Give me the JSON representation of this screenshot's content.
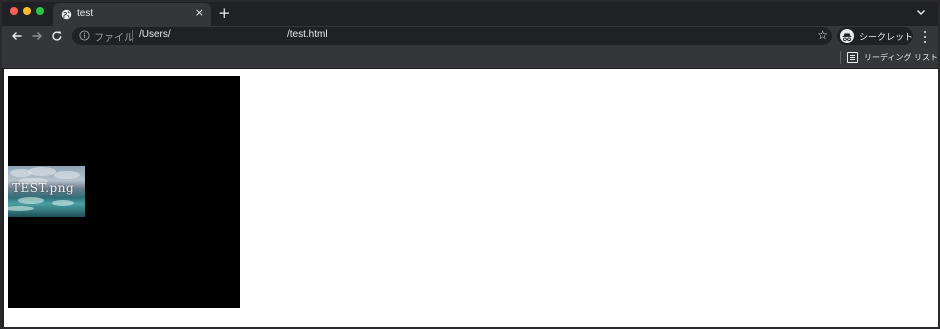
{
  "window": {
    "controls": [
      "close",
      "minimize",
      "maximize"
    ]
  },
  "tab": {
    "title": "test",
    "icon": "globe-icon",
    "close_glyph": "×"
  },
  "new_tab_glyph": "+",
  "toolbar": {
    "back_icon": "arrow-left-icon",
    "forward_icon": "arrow-right-icon",
    "reload_icon": "reload-icon",
    "address": {
      "scheme_label": "ファイル",
      "url_part1": "/Users/",
      "url_part2": "/test.html",
      "bookmark_icon": "star-icon",
      "star_glyph": "☆"
    },
    "incognito_label": "シークレット",
    "menu_icon": "more-vert-icon"
  },
  "bookmarks_bar": {
    "reading_list_label": "リーディング リスト"
  },
  "page": {
    "image_caption": "TEST.png"
  },
  "colors": {
    "chrome_dark": "#202124",
    "toolbar": "#35363a",
    "content_bg": "#ffffff",
    "canvas_bg": "#000000"
  }
}
